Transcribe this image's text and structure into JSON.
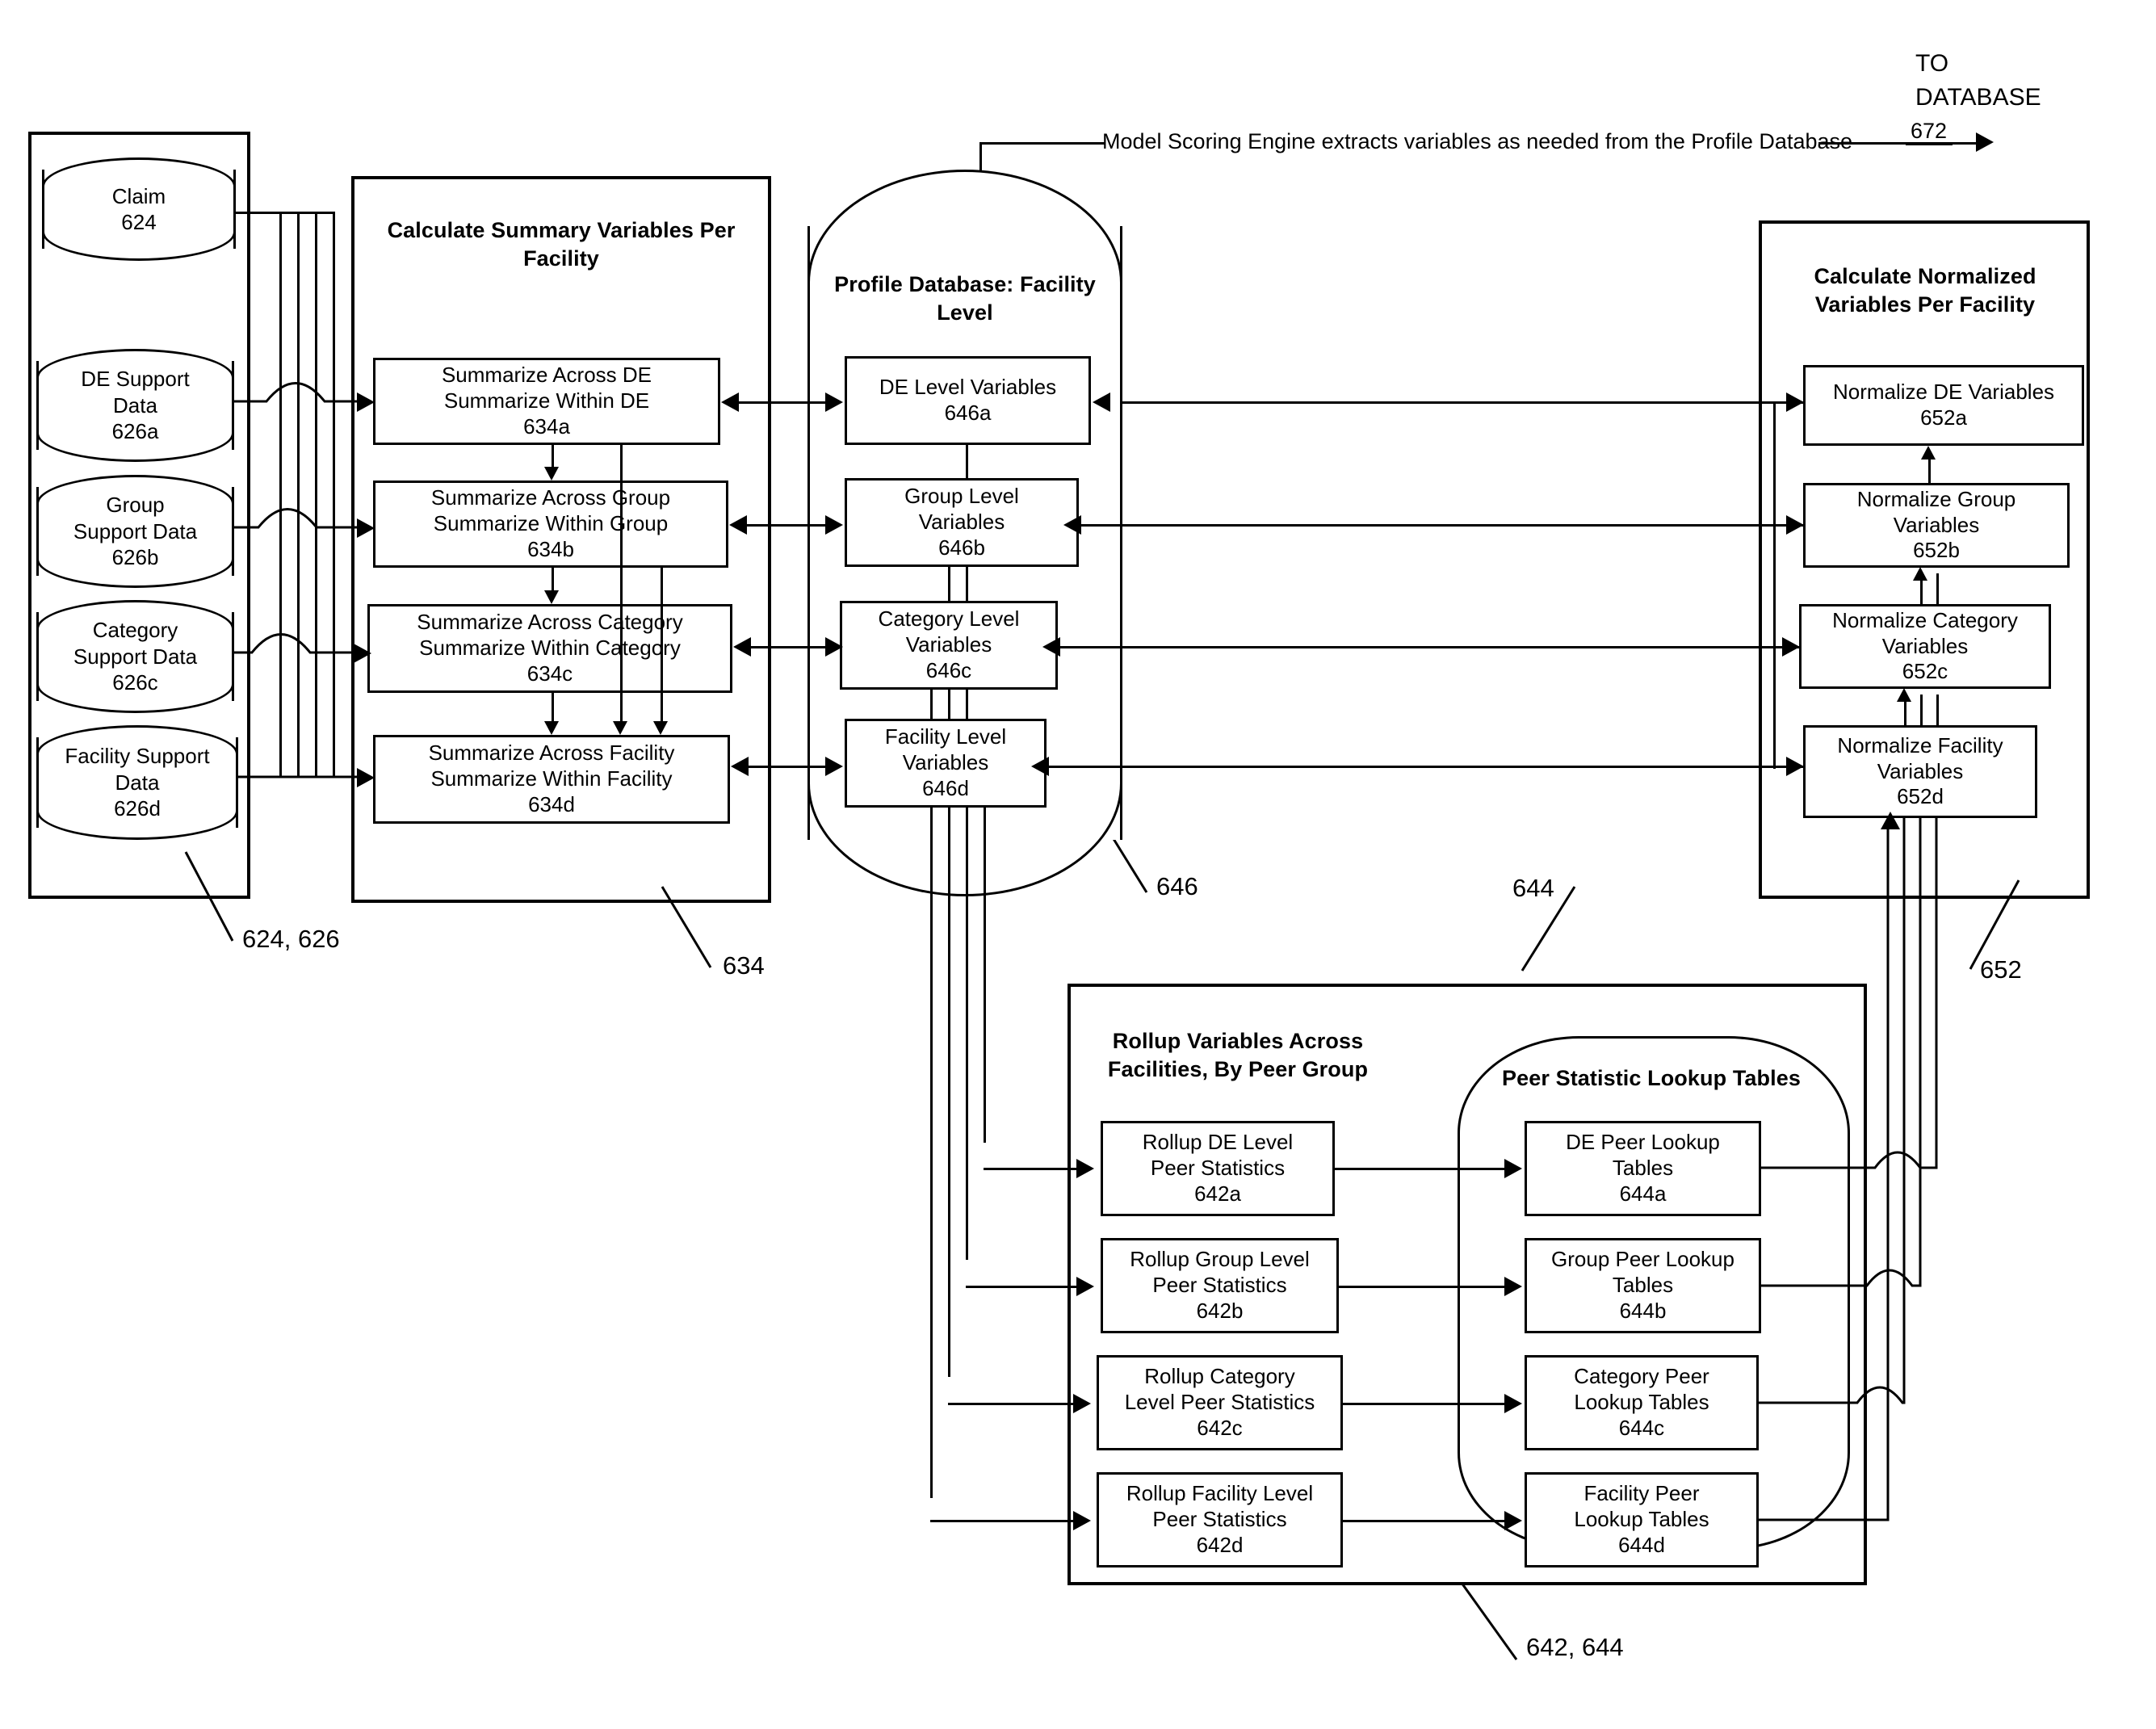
{
  "figure": {
    "top_annotation": "Model Scoring Engine extracts variables as needed from the Profile Database",
    "to_database_line1": "TO",
    "to_database_line2": "DATABASE",
    "to_database_ref": "672"
  },
  "source_group": {
    "ref": "624, 626",
    "stores": [
      {
        "name": "data-store-claim",
        "line1": "Claim",
        "line2": "",
        "ref": "624"
      },
      {
        "name": "data-store-de-support",
        "line1": "DE Support",
        "line2": "Data",
        "ref": "626a"
      },
      {
        "name": "data-store-group-support",
        "line1": "Group",
        "line2": "Support Data",
        "ref": "626b"
      },
      {
        "name": "data-store-category-support",
        "line1": "Category",
        "line2": "Support Data",
        "ref": "626c"
      },
      {
        "name": "data-store-facility-support",
        "line1": "Facility Support",
        "line2": "Data",
        "ref": "626d"
      }
    ]
  },
  "summary_group": {
    "title_line1": "Calculate Summary",
    "title_line2": "Variables Per Facility",
    "ref": "634",
    "nodes": [
      {
        "line1": "Summarize Across DE",
        "line2": "Summarize Within DE",
        "ref": "634a"
      },
      {
        "line1": "Summarize Across Group",
        "line2": "Summarize Within Group",
        "ref": "634b"
      },
      {
        "line1": "Summarize Across Category",
        "line2": "Summarize Within Category",
        "ref": "634c"
      },
      {
        "line1": "Summarize Across Facility",
        "line2": "Summarize Within Facility",
        "ref": "634d"
      }
    ]
  },
  "profile_db": {
    "title_line1": "Profile Database:",
    "title_line2": "Facility Level",
    "ref": "646",
    "nodes": [
      {
        "line1": "DE Level Variables",
        "line2": "",
        "ref": "646a"
      },
      {
        "line1": "Group Level",
        "line2": "Variables",
        "ref": "646b"
      },
      {
        "line1": "Category Level",
        "line2": "Variables",
        "ref": "646c"
      },
      {
        "line1": "Facility Level",
        "line2": "Variables",
        "ref": "646d"
      }
    ]
  },
  "normalize_group": {
    "title_line1": "Calculate Normalized",
    "title_line2": "Variables",
    "title_line3": "Per Facility",
    "ref": "652",
    "nodes": [
      {
        "line1": "Normalize DE Variables",
        "line2": "",
        "ref": "652a"
      },
      {
        "line1": "Normalize Group",
        "line2": "Variables",
        "ref": "652b"
      },
      {
        "line1": "Normalize Category",
        "line2": "Variables",
        "ref": "652c"
      },
      {
        "line1": "Normalize Facility",
        "line2": "Variables",
        "ref": "652d"
      }
    ]
  },
  "rollup_group": {
    "ref": "642, 644",
    "rollup_title_line1": "Rollup Variables Across",
    "rollup_title_line2": "Facilities, By Peer",
    "rollup_title_line3": "Group",
    "lookup_title_line1": "Peer Statistic Lookup",
    "lookup_title_line2": "Tables",
    "lookup_ref": "644",
    "rollup_nodes": [
      {
        "line1": "Rollup DE Level",
        "line2": "Peer Statistics",
        "ref": "642a"
      },
      {
        "line1": "Rollup Group Level",
        "line2": "Peer Statistics",
        "ref": "642b"
      },
      {
        "line1": "Rollup Category",
        "line2": "Level Peer Statistics",
        "ref": "642c"
      },
      {
        "line1": "Rollup Facility Level",
        "line2": "Peer Statistics",
        "ref": "642d"
      }
    ],
    "lookup_nodes": [
      {
        "line1": "DE Peer Lookup",
        "line2": "Tables",
        "ref": "644a"
      },
      {
        "line1": "Group Peer Lookup",
        "line2": "Tables",
        "ref": "644b"
      },
      {
        "line1": "Category Peer",
        "line2": "Lookup Tables",
        "ref": "644c"
      },
      {
        "line1": "Facility Peer",
        "line2": "Lookup Tables",
        "ref": "644d"
      }
    ]
  },
  "colors": {
    "ink": "#000000",
    "paper": "#ffffff"
  }
}
